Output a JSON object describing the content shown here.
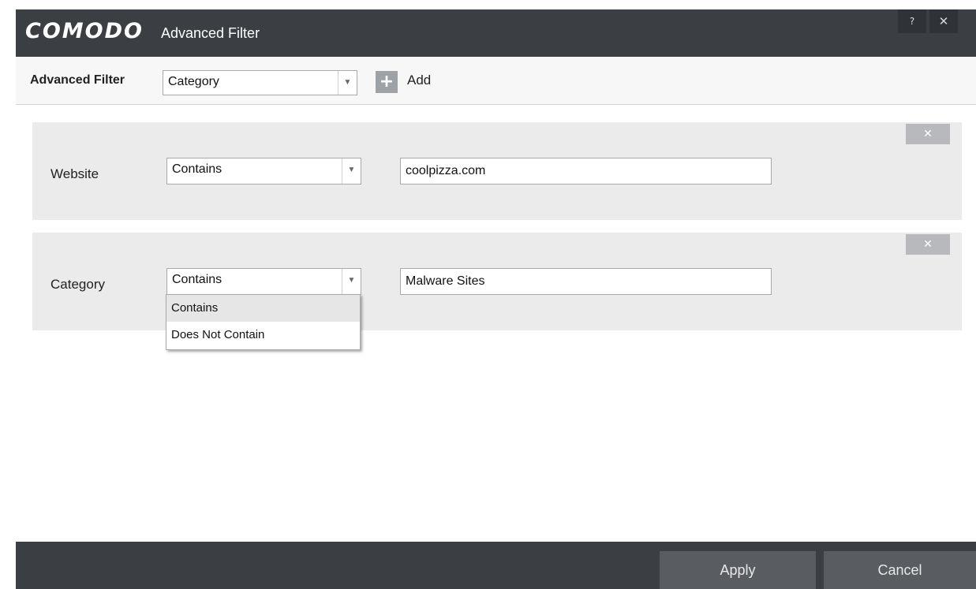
{
  "window": {
    "brand": "COMODO",
    "title": "Advanced Filter",
    "help_label": "?",
    "close_label": "✕"
  },
  "toolbar": {
    "label": "Advanced Filter",
    "filter_select": "Category",
    "add_icon": "+",
    "add_label": "Add"
  },
  "rows": [
    {
      "label": "Website",
      "operator": "Contains",
      "value": "coolpizza.com",
      "remove_label": "✕"
    },
    {
      "label": "Category",
      "operator": "Contains",
      "value": "Malware Sites",
      "remove_label": "✕"
    }
  ],
  "dropdown": {
    "options": [
      "Contains",
      "Does Not Contain"
    ],
    "highlighted": "Contains"
  },
  "footer": {
    "apply_label": "Apply",
    "cancel_label": "Cancel"
  },
  "colors": {
    "chrome": "#3b3f44",
    "button": "#595d62",
    "row_bg": "#ebebeb"
  }
}
